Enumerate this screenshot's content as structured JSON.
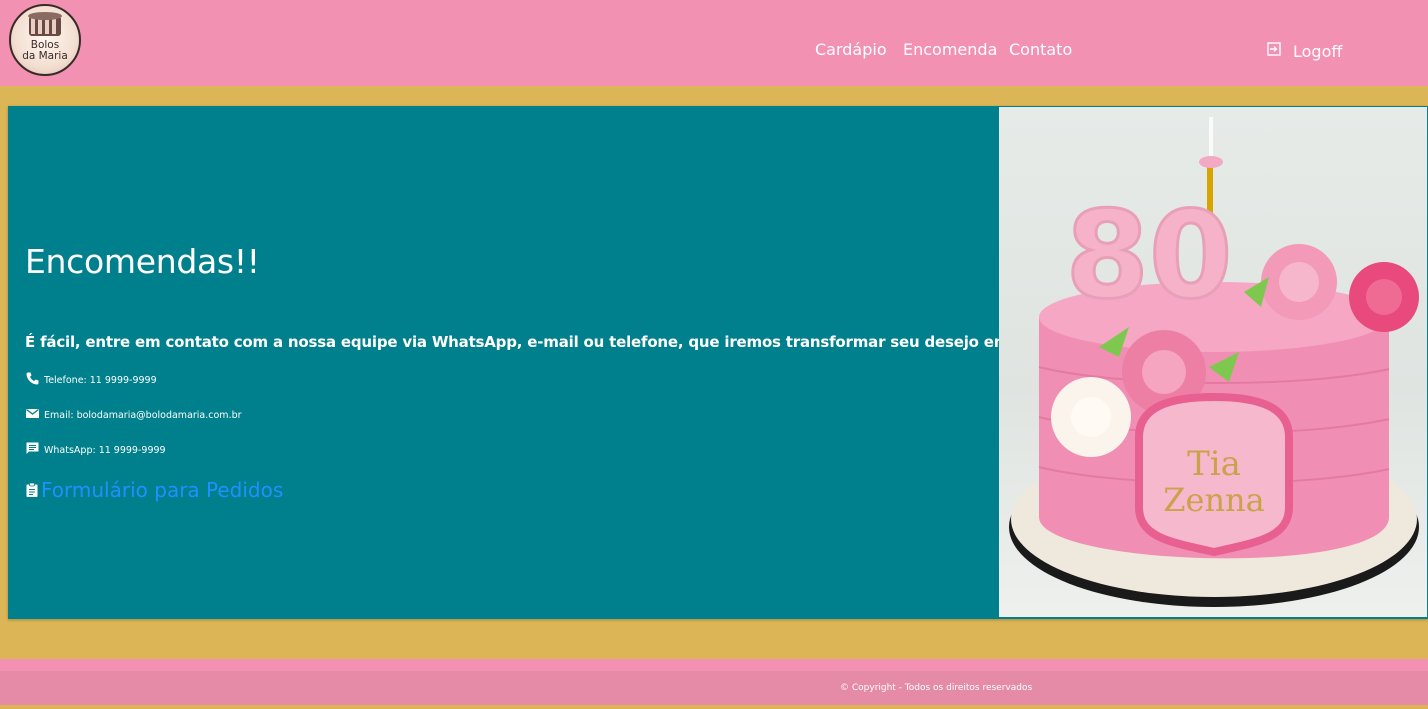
{
  "header": {
    "logo_text_line1": "Bolos",
    "logo_text_line2": "da Maria",
    "nav": [
      "Cardápio",
      "Encomenda",
      "Contato"
    ],
    "logoff_label": "Logoff"
  },
  "main": {
    "title": "Encomendas!!",
    "lead": "É fácil, entre em contato com a nossa equipe via WhatsApp, e-mail ou telefone, que iremos transformar seu desejo em realidade!",
    "contacts": [
      {
        "icon": "phone-icon",
        "text": "Telefone: 11 9999-9999"
      },
      {
        "icon": "email-icon",
        "text": "Email: bolodamaria@bolodamaria.com.br"
      },
      {
        "icon": "chat-icon",
        "text": "WhatsApp: 11 9999-9999"
      }
    ],
    "form_link": "Formulário para Pedidos",
    "cake_number": "80",
    "cake_plaque": [
      "Tia",
      "Zenna"
    ]
  },
  "footer": {
    "copyright": "© Copyright - Todos os direitos reservados"
  },
  "colors": {
    "header_bg": "#f391b3",
    "page_bg": "#dcb656",
    "card_bg": "#00808c",
    "link": "#1e90ff",
    "footer_bg": "#e58ba8"
  }
}
